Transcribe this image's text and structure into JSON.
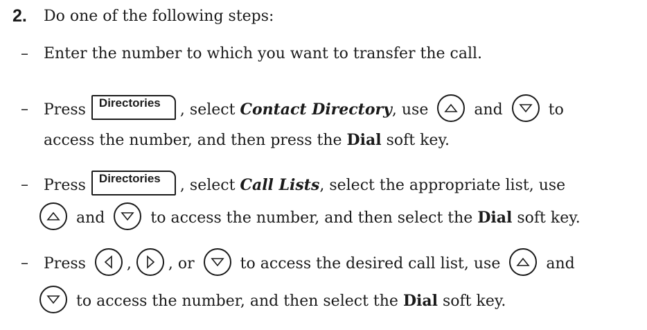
{
  "step": {
    "number": "2.",
    "intro": "Do one of the following steps:"
  },
  "dash": "–",
  "items": [
    {
      "text": "Enter the number to which you want to transfer the call."
    },
    {
      "press": "Press",
      "button": "Directories",
      "t1": ", select ",
      "bold1": "Contact Directory",
      "t2": ", use",
      "and": "and",
      "to": "to",
      "line2a": "access the number, and then press the ",
      "dial": "Dial",
      "line2b": " soft key."
    },
    {
      "press": "Press",
      "button": "Directories",
      "t1": ", select ",
      "bold1": "Call Lists",
      "t2": ", select the appropriate list, use",
      "and": "and",
      "line2a": "to access the number, and then select the ",
      "dial": "Dial",
      "line2b": " soft key."
    },
    {
      "press": "Press",
      "c1": ",",
      "c2": ", or",
      "t1": "to access the desired call list, use",
      "and": "and",
      "line2a": "to access the number, and then select the ",
      "dial": "Dial",
      "line2b": " soft key."
    }
  ],
  "icons": [
    "up-arrow-key-icon",
    "down-arrow-key-icon",
    "left-arrow-key-icon",
    "right-arrow-key-icon"
  ]
}
